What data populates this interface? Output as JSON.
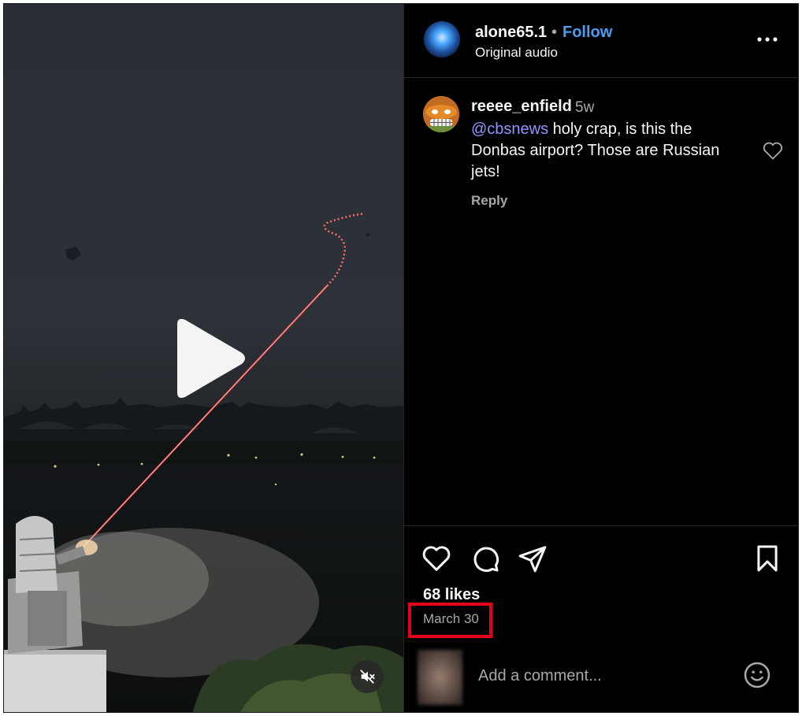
{
  "post": {
    "username": "alone65.1",
    "separator": "•",
    "follow_label": "Follow",
    "audio": "Original audio"
  },
  "comment": {
    "username": "reeee_enfield",
    "time": "5w",
    "mention": "@cbsnews",
    "text": " holy crap, is this the Donbas airport? Those are Russian jets!",
    "reply_label": "Reply"
  },
  "stats": {
    "likes": "68 likes",
    "date": "March 30"
  },
  "composer": {
    "placeholder": "Add a comment..."
  },
  "icons": [
    "play-icon",
    "mute-icon",
    "more-icon",
    "heart-icon",
    "comment-icon",
    "share-icon",
    "bookmark-icon",
    "emoji-icon"
  ],
  "colors": {
    "follow": "#4a9df0",
    "mention": "#8e96ff",
    "highlight_box": "#e3001b"
  }
}
